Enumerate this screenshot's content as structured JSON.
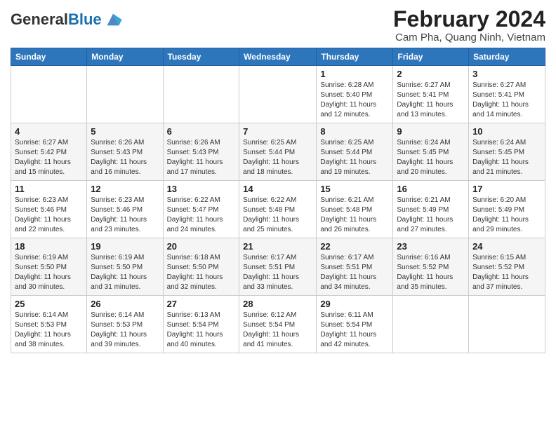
{
  "header": {
    "logo_general": "General",
    "logo_blue": "Blue",
    "month_year": "February 2024",
    "location": "Cam Pha, Quang Ninh, Vietnam"
  },
  "days_of_week": [
    "Sunday",
    "Monday",
    "Tuesday",
    "Wednesday",
    "Thursday",
    "Friday",
    "Saturday"
  ],
  "weeks": [
    [
      {
        "day": "",
        "info": ""
      },
      {
        "day": "",
        "info": ""
      },
      {
        "day": "",
        "info": ""
      },
      {
        "day": "",
        "info": ""
      },
      {
        "day": "1",
        "info": "Sunrise: 6:28 AM\nSunset: 5:40 PM\nDaylight: 11 hours\nand 12 minutes."
      },
      {
        "day": "2",
        "info": "Sunrise: 6:27 AM\nSunset: 5:41 PM\nDaylight: 11 hours\nand 13 minutes."
      },
      {
        "day": "3",
        "info": "Sunrise: 6:27 AM\nSunset: 5:41 PM\nDaylight: 11 hours\nand 14 minutes."
      }
    ],
    [
      {
        "day": "4",
        "info": "Sunrise: 6:27 AM\nSunset: 5:42 PM\nDaylight: 11 hours\nand 15 minutes."
      },
      {
        "day": "5",
        "info": "Sunrise: 6:26 AM\nSunset: 5:43 PM\nDaylight: 11 hours\nand 16 minutes."
      },
      {
        "day": "6",
        "info": "Sunrise: 6:26 AM\nSunset: 5:43 PM\nDaylight: 11 hours\nand 17 minutes."
      },
      {
        "day": "7",
        "info": "Sunrise: 6:25 AM\nSunset: 5:44 PM\nDaylight: 11 hours\nand 18 minutes."
      },
      {
        "day": "8",
        "info": "Sunrise: 6:25 AM\nSunset: 5:44 PM\nDaylight: 11 hours\nand 19 minutes."
      },
      {
        "day": "9",
        "info": "Sunrise: 6:24 AM\nSunset: 5:45 PM\nDaylight: 11 hours\nand 20 minutes."
      },
      {
        "day": "10",
        "info": "Sunrise: 6:24 AM\nSunset: 5:45 PM\nDaylight: 11 hours\nand 21 minutes."
      }
    ],
    [
      {
        "day": "11",
        "info": "Sunrise: 6:23 AM\nSunset: 5:46 PM\nDaylight: 11 hours\nand 22 minutes."
      },
      {
        "day": "12",
        "info": "Sunrise: 6:23 AM\nSunset: 5:46 PM\nDaylight: 11 hours\nand 23 minutes."
      },
      {
        "day": "13",
        "info": "Sunrise: 6:22 AM\nSunset: 5:47 PM\nDaylight: 11 hours\nand 24 minutes."
      },
      {
        "day": "14",
        "info": "Sunrise: 6:22 AM\nSunset: 5:48 PM\nDaylight: 11 hours\nand 25 minutes."
      },
      {
        "day": "15",
        "info": "Sunrise: 6:21 AM\nSunset: 5:48 PM\nDaylight: 11 hours\nand 26 minutes."
      },
      {
        "day": "16",
        "info": "Sunrise: 6:21 AM\nSunset: 5:49 PM\nDaylight: 11 hours\nand 27 minutes."
      },
      {
        "day": "17",
        "info": "Sunrise: 6:20 AM\nSunset: 5:49 PM\nDaylight: 11 hours\nand 29 minutes."
      }
    ],
    [
      {
        "day": "18",
        "info": "Sunrise: 6:19 AM\nSunset: 5:50 PM\nDaylight: 11 hours\nand 30 minutes."
      },
      {
        "day": "19",
        "info": "Sunrise: 6:19 AM\nSunset: 5:50 PM\nDaylight: 11 hours\nand 31 minutes."
      },
      {
        "day": "20",
        "info": "Sunrise: 6:18 AM\nSunset: 5:50 PM\nDaylight: 11 hours\nand 32 minutes."
      },
      {
        "day": "21",
        "info": "Sunrise: 6:17 AM\nSunset: 5:51 PM\nDaylight: 11 hours\nand 33 minutes."
      },
      {
        "day": "22",
        "info": "Sunrise: 6:17 AM\nSunset: 5:51 PM\nDaylight: 11 hours\nand 34 minutes."
      },
      {
        "day": "23",
        "info": "Sunrise: 6:16 AM\nSunset: 5:52 PM\nDaylight: 11 hours\nand 35 minutes."
      },
      {
        "day": "24",
        "info": "Sunrise: 6:15 AM\nSunset: 5:52 PM\nDaylight: 11 hours\nand 37 minutes."
      }
    ],
    [
      {
        "day": "25",
        "info": "Sunrise: 6:14 AM\nSunset: 5:53 PM\nDaylight: 11 hours\nand 38 minutes."
      },
      {
        "day": "26",
        "info": "Sunrise: 6:14 AM\nSunset: 5:53 PM\nDaylight: 11 hours\nand 39 minutes."
      },
      {
        "day": "27",
        "info": "Sunrise: 6:13 AM\nSunset: 5:54 PM\nDaylight: 11 hours\nand 40 minutes."
      },
      {
        "day": "28",
        "info": "Sunrise: 6:12 AM\nSunset: 5:54 PM\nDaylight: 11 hours\nand 41 minutes."
      },
      {
        "day": "29",
        "info": "Sunrise: 6:11 AM\nSunset: 5:54 PM\nDaylight: 11 hours\nand 42 minutes."
      },
      {
        "day": "",
        "info": ""
      },
      {
        "day": "",
        "info": ""
      }
    ]
  ]
}
